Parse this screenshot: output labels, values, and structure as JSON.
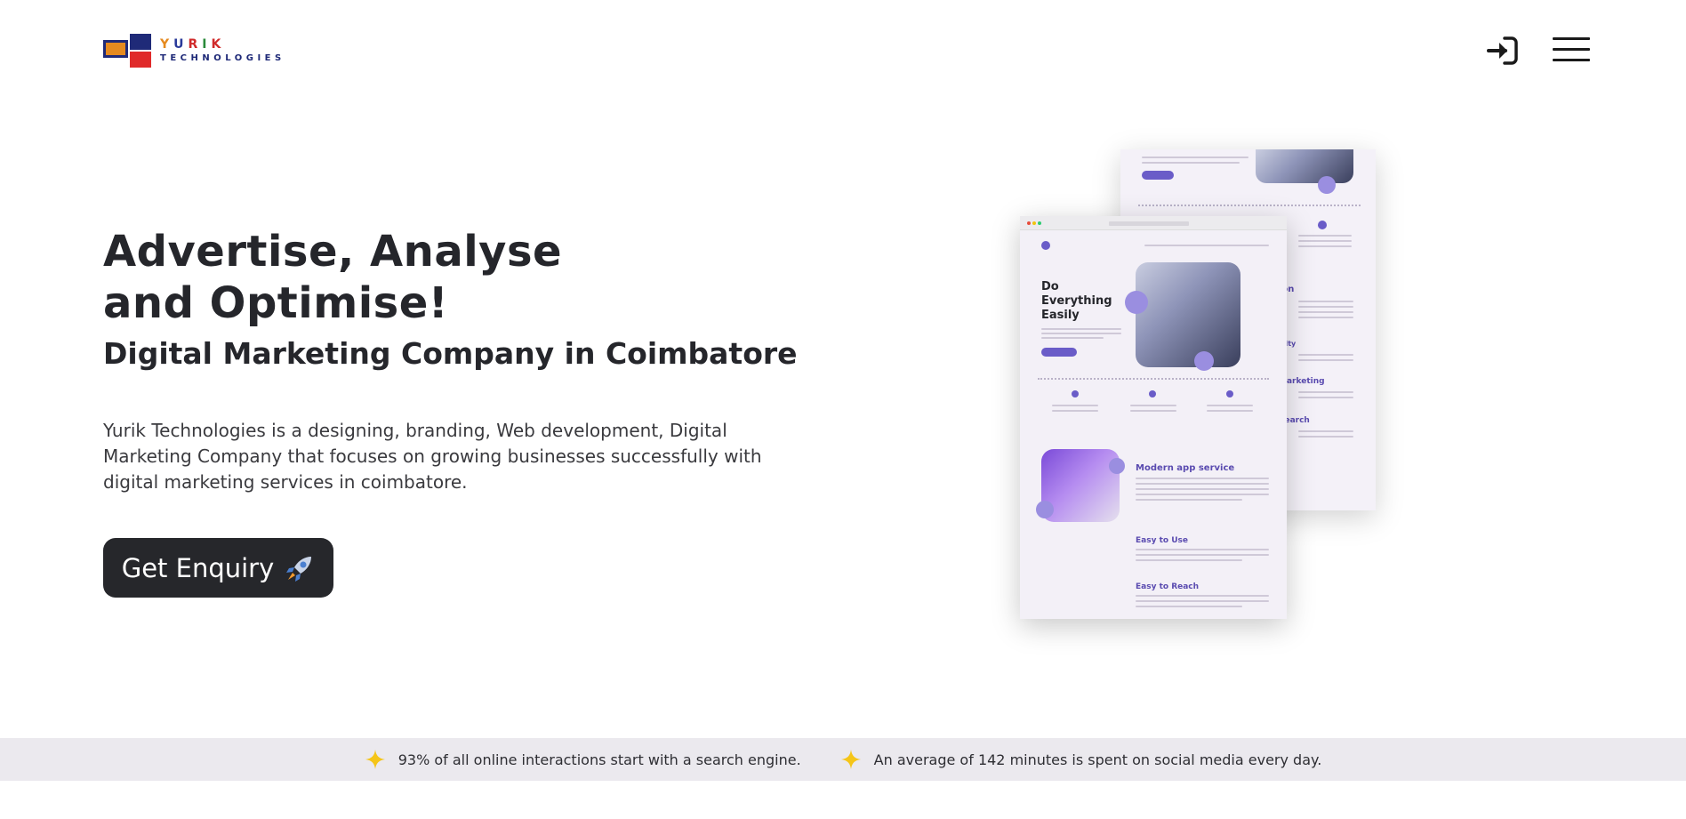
{
  "header": {
    "logo": {
      "brand": "YURIK",
      "sub": "TECHNOLOGIES"
    }
  },
  "hero": {
    "title_line1": "Advertise, Analyse",
    "title_line2": "and Optimise!",
    "subtitle": "Digital Marketing Company in Coimbatore",
    "description": "Yurik Technologies is a designing, branding, Web development, Digital Marketing Company that focuses on growing businesses successfully with digital marketing services in coimbatore.",
    "cta_label": "Get Enquiry",
    "cta_icon": "rocket-icon"
  },
  "mockup": {
    "headline_1": "Do",
    "headline_2": "Everything",
    "headline_3": "Easily",
    "section_title": "Modern app service",
    "item_1": "Easy to Use",
    "item_2": "Easy to Reach"
  },
  "facts": {
    "fact_1": "93% of all online interactions start with a search engine.",
    "fact_2": "An average of 142 minutes is spent on social media every day.",
    "icon": "sparkle-icon"
  },
  "colors": {
    "accent": "#26272b",
    "sparkle": "#f5c518",
    "purple": "#5a4bb0"
  }
}
